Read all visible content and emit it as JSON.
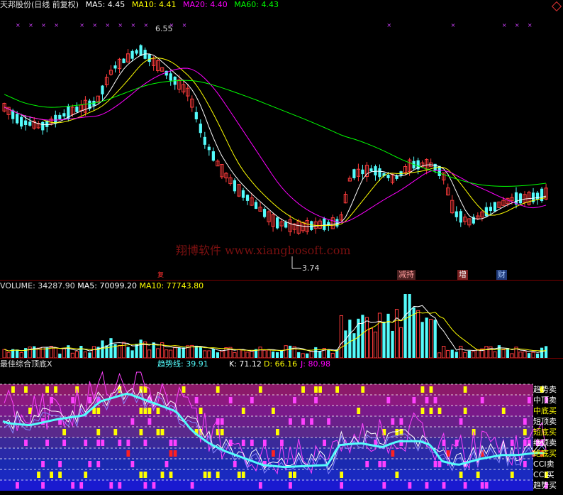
{
  "title": {
    "name": "天邦股份(日线 前复权)",
    "ma5": "MA5: 4.45",
    "ma10": "MA10: 4.41",
    "ma20": "MA20: 4.40",
    "ma60": "MA60: 4.43"
  },
  "price_panel": {
    "high_label": "6.55",
    "low_label": "3.74",
    "watermark": "翔博软件 www.xiangbosoft.com",
    "markers": [
      "复",
      "增",
      "财"
    ],
    "marker_partial": "减持"
  },
  "volume_panel": {
    "volume": "VOLUME: 34287.90",
    "ma5": "MA5: 70099.20",
    "ma10": "MA10: 77743.80"
  },
  "indicator_panel": {
    "name": "最佳综合顶底X",
    "trend": "趋势线: 39.91",
    "k": "K: 71.12",
    "d": "D: 66.16",
    "j": "J: 80.98",
    "band_labels": [
      "趋势卖",
      "中顶卖",
      "中底买",
      "短顶卖",
      "短底买",
      "绝顶卖",
      "绝底买",
      "CCI卖",
      "CCI买",
      "趋势买"
    ]
  },
  "colors": {
    "up": "#ff3c3c",
    "down": "#54fcfc",
    "ma5": "#ffffff",
    "ma10": "#ffff00",
    "ma20": "#ff00ff",
    "ma60": "#00ff00"
  }
}
